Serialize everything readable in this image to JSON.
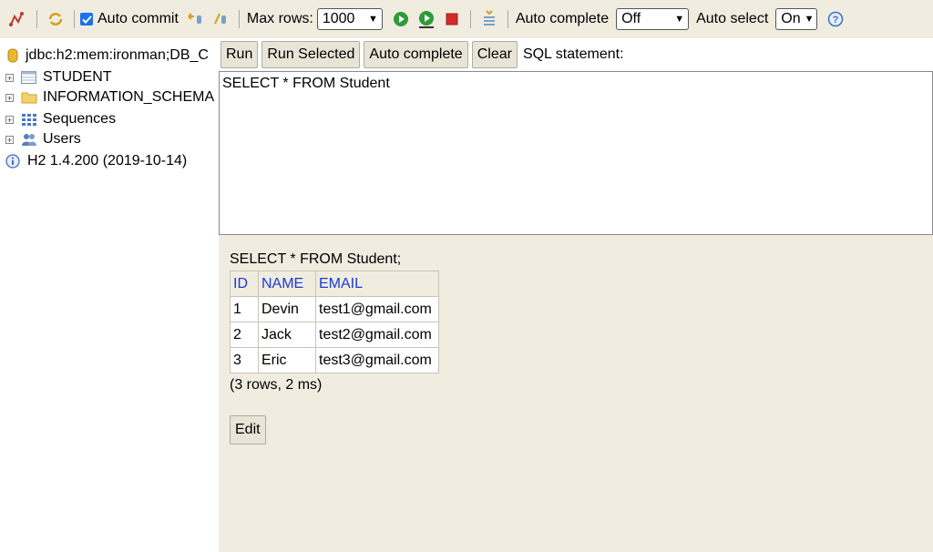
{
  "toolbar": {
    "auto_commit_label": "Auto commit",
    "auto_commit_checked": true,
    "max_rows_label": "Max rows:",
    "max_rows_value": "1000",
    "auto_complete_label": "Auto complete",
    "auto_complete_value": "Off",
    "auto_select_label": "Auto select",
    "auto_select_value": "On"
  },
  "tree": {
    "connection": "jdbc:h2:mem:ironman;DB_C",
    "items": [
      {
        "label": "STUDENT"
      },
      {
        "label": "INFORMATION_SCHEMA"
      },
      {
        "label": "Sequences"
      },
      {
        "label": "Users"
      }
    ],
    "version": "H2 1.4.200 (2019-10-14)"
  },
  "buttons": {
    "run": "Run",
    "run_selected": "Run Selected",
    "auto_complete": "Auto complete",
    "clear": "Clear",
    "sql_statement_label": "SQL statement:"
  },
  "editor": {
    "text": "SELECT * FROM Student"
  },
  "result": {
    "query": "SELECT * FROM Student;",
    "columns": [
      "ID",
      "NAME",
      "EMAIL"
    ],
    "rows": [
      [
        "1",
        "Devin",
        "test1@gmail.com"
      ],
      [
        "2",
        "Jack",
        "test2@gmail.com"
      ],
      [
        "3",
        "Eric",
        "test3@gmail.com"
      ]
    ],
    "summary": "(3 rows, 2 ms)",
    "edit_label": "Edit"
  },
  "colors": {
    "panel_bg": "#f0ece0",
    "header_text": "#1a3ad6",
    "run_green": "#2e9b3a",
    "stop_red": "#d42a2a"
  }
}
